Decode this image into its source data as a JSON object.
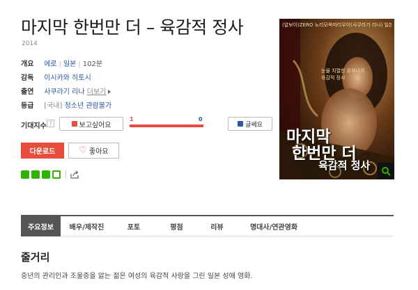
{
  "movie": {
    "title": "마지막 한번만 더 – 육감적 정사",
    "year": "2014"
  },
  "info": {
    "overview_label": "개요",
    "genre": "에로",
    "country": "일본",
    "runtime": "102분",
    "director_label": "감독",
    "director": "이시카와 히토시",
    "cast_label": "출연",
    "cast": "사쿠라기 리나",
    "cast_more": "더보기",
    "rating_label": "등급",
    "rating_region": "[국내]",
    "rating": "청소년 관람불가"
  },
  "anticipation": {
    "label": "기대지수",
    "help": "?",
    "want_label": "보고싶어요",
    "want_count": "1",
    "not_want_count": "0",
    "not_want_label": "글쎄요",
    "bar_fill_ratio": 1.0
  },
  "actions": {
    "download_label": "다운로드",
    "like_label": "좋아요"
  },
  "poster": {
    "top_text": "(알보이)ZERO 노리모쏙따리우이(사쿠라기 리나) 일본 성애",
    "mid_text_1": "눈물 치열한 유부녀의",
    "mid_text_2": "육감적 정사",
    "title_1": "마지막",
    "title_2": "한번만 더",
    "title_3": "육감적 정사"
  },
  "tabs": [
    {
      "label": "주요정보",
      "active": true
    },
    {
      "label": "배우/제작진",
      "active": false
    },
    {
      "label": "포토",
      "active": false
    },
    {
      "label": "평점",
      "active": false
    },
    {
      "label": "리뷰",
      "active": false
    },
    {
      "label": "명대사/연관영화",
      "active": false
    }
  ],
  "synopsis": {
    "title": "줄거리",
    "text": "중년의 관리인과 조울증을 앓는 젊은 여성의 육감적 사랑을 그린 일본 성애 영화."
  },
  "colors": {
    "accent_red": "#e74c3c",
    "link_blue": "#2a57a6",
    "naver_green": "#2db400",
    "tab_dark": "#555555"
  }
}
